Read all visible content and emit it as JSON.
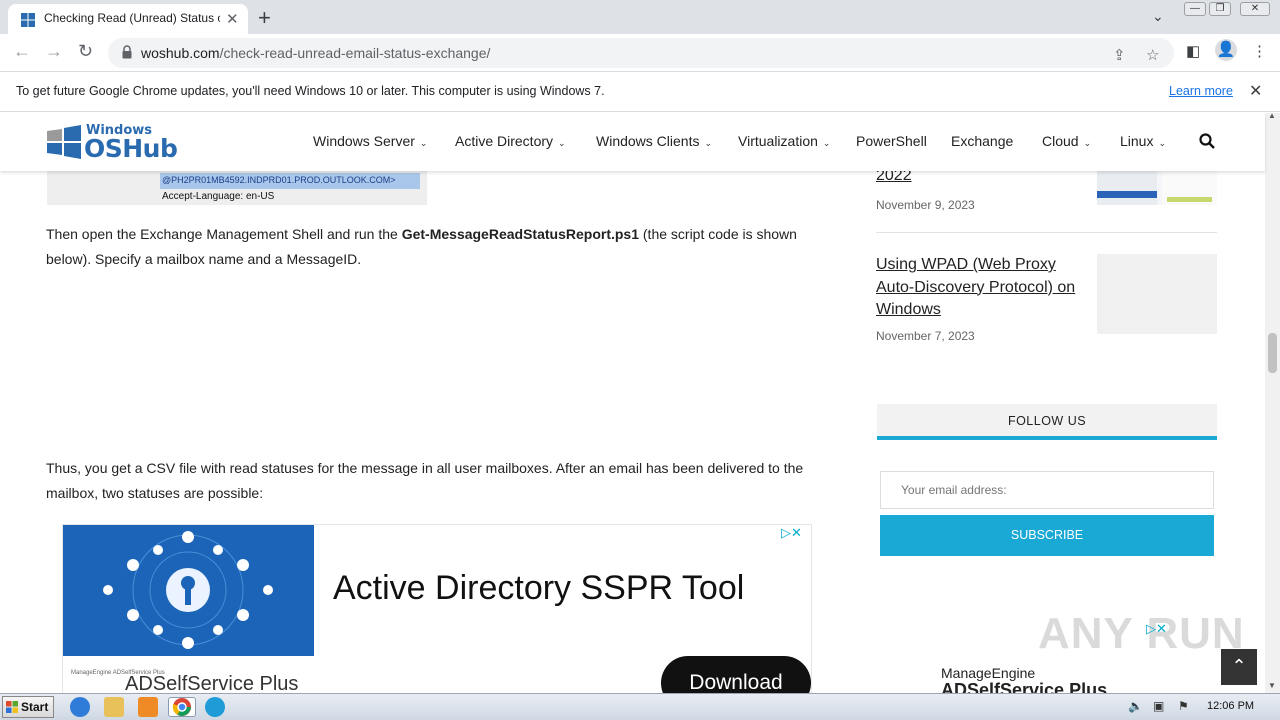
{
  "browser": {
    "tab_title": "Checking Read (Unread) Status of E",
    "url_host": "woshub.com",
    "url_path": "/check-read-unread-email-status-exchange/",
    "infobar_text": "To get future Google Chrome updates, you'll need Windows 10 or later. This computer is using Windows 7.",
    "infobar_link": "Learn more"
  },
  "site": {
    "logo_top": "Windows",
    "logo_bottom": "OSHub",
    "menu": [
      {
        "label": "Windows Server"
      },
      {
        "label": "Active Directory"
      },
      {
        "label": "Windows Clients"
      },
      {
        "label": "Virtualization"
      },
      {
        "label": "PowerShell"
      },
      {
        "label": "Exchange"
      },
      {
        "label": "Cloud"
      },
      {
        "label": "Linux"
      }
    ]
  },
  "article": {
    "image_line1": "@PH2PR01MB4592.INDPRD01.PROD.OUTLOOK.COM>",
    "image_line2": "Accept-Language: en-US",
    "para1_pre": "Then open the Exchange Management Shell and run the ",
    "para1_bold": "Get-MessageReadStatusReport.ps1",
    "para1_post": " (the script code is shown below). Specify a mailbox name and a MessageID.",
    "para2": "Thus, you get a CSV file with read statuses for the message in all user mailboxes. After an email has been delivered to the mailbox, two statuses are possible:"
  },
  "ad": {
    "title": "Active Directory SSPR Tool",
    "brand": "ADSelfService Plus",
    "brand_small": "ManageEngine ADSelfService Plus",
    "download": "Download",
    "choices": "▷✕"
  },
  "sidebar": {
    "post1_title": "2022",
    "post1_date": "November 9, 2023",
    "post2_title": "Using WPAD (Web Proxy Auto-Discovery Protocol) on Windows",
    "post2_date": "November 7, 2023",
    "follow_label": "FOLLOW US",
    "email_placeholder": "Your email address:",
    "subscribe": "SUBSCRIBE",
    "ad_brand": "ManageEngine",
    "ad_product": "ADSelfService Plus",
    "watermark": "ANY RUN"
  },
  "taskbar": {
    "start": "Start",
    "clock": "12:06 PM"
  }
}
